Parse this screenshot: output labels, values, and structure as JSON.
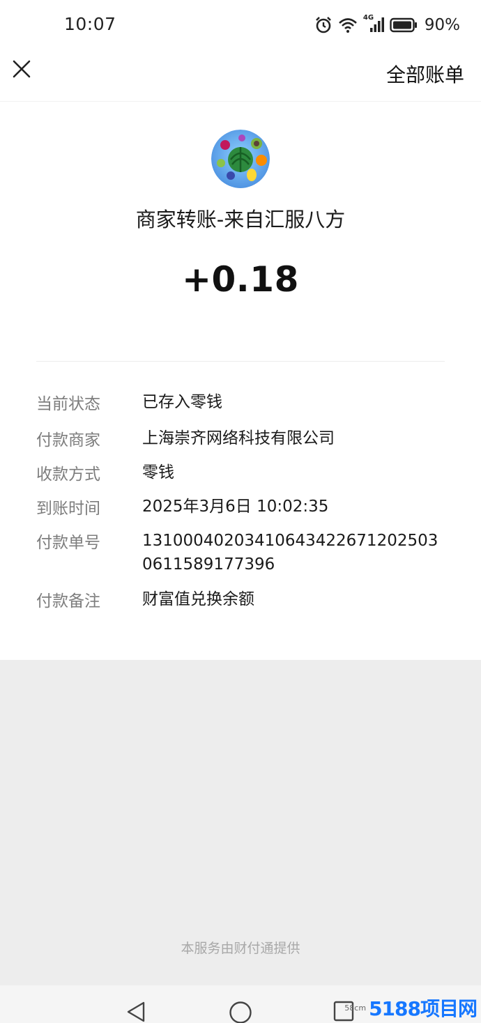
{
  "status_bar": {
    "time": "10:07",
    "network": "4G",
    "battery": "90%",
    "icons": [
      "alarm-icon",
      "wifi-icon",
      "signal-icon",
      "battery-icon"
    ]
  },
  "header": {
    "close_icon": "close-icon",
    "all_bills_label": "全部账单"
  },
  "merchant": {
    "avatar_icon": "fruit-game-avatar",
    "title": "商家转账-来自汇服八方",
    "amount": "+0.18"
  },
  "details": [
    {
      "label": "当前状态",
      "value": "已存入零钱"
    },
    {
      "label": "付款商家",
      "value": "上海崇齐网络科技有限公司"
    },
    {
      "label": "收款方式",
      "value": "零钱"
    },
    {
      "label": "到账时间",
      "value": "2025年3月6日 10:02:35"
    },
    {
      "label": "付款单号",
      "value": "131000402034106434226712025030611589177396"
    },
    {
      "label": "付款备注",
      "value": "财富值兑换余额"
    }
  ],
  "footer": {
    "note": "本服务由财付通提供"
  },
  "nav_bar": {
    "icons": [
      "back-triangle-icon",
      "home-circle-icon",
      "recents-square-icon"
    ]
  },
  "watermark": {
    "small_text": "58cm",
    "brand": "5188项目网"
  },
  "colors": {
    "page_bg": "#ededed",
    "card_bg": "#ffffff",
    "label_gray": "#7d7d7d",
    "watermark_blue": "#1677ff"
  }
}
